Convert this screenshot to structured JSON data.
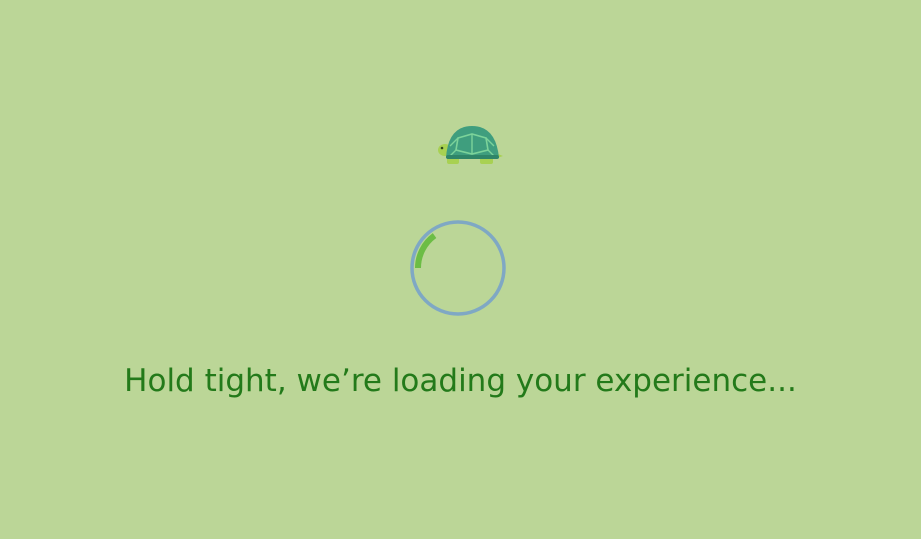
{
  "loading": {
    "icon": "turtle-icon",
    "message": "Hold tight, we’re loading your experience...",
    "progress": 0.15
  },
  "colors": {
    "background": "#bbd697",
    "message_text": "#237a1a",
    "spinner_track": "#7fa8c4",
    "spinner_arc": "#6cbd45",
    "turtle_shell": "#3f9e7e",
    "turtle_pattern": "#7cd39a",
    "turtle_body": "#a8d152"
  }
}
